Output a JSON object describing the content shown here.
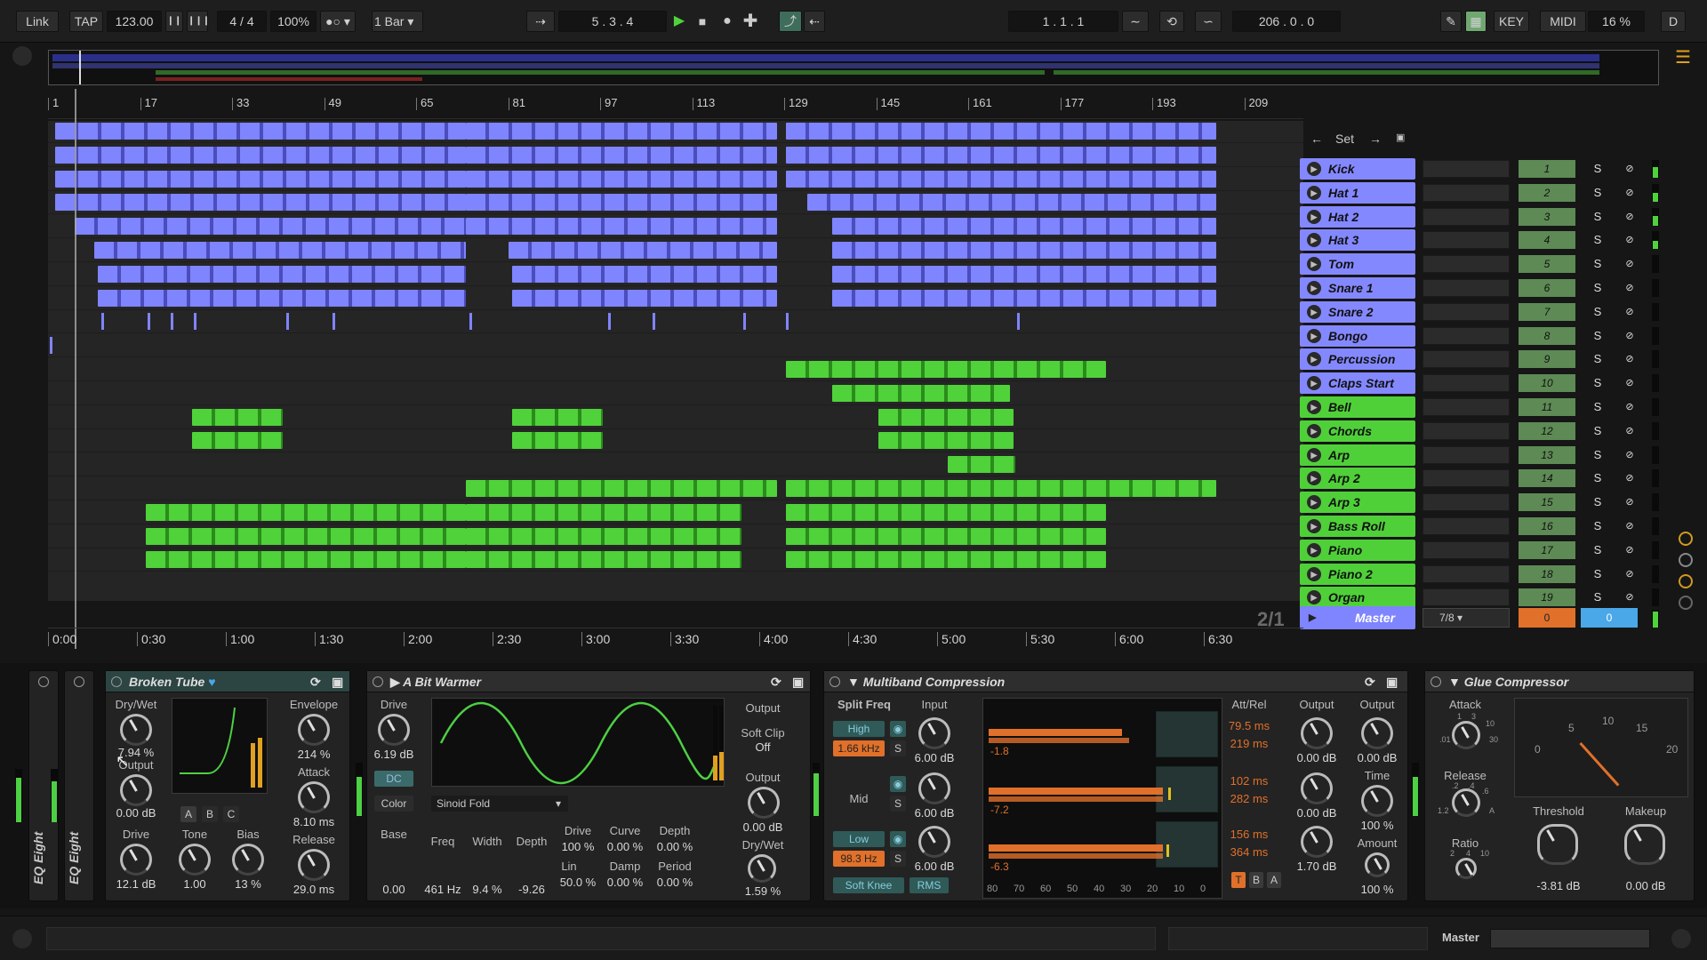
{
  "transport": {
    "link": "Link",
    "tap": "TAP",
    "tempo": "123.00",
    "meter": "4 / 4",
    "zoom": "100%",
    "quant": "1 Bar",
    "position": "5 .  3 .  4",
    "loop_start": "1 .  1 .  1",
    "loop_len": "206 .  0 .  0",
    "key": "KEY",
    "midi": "MIDI",
    "cpu": "16 %",
    "disk": "D"
  },
  "ruler": [
    "1",
    "17",
    "33",
    "49",
    "65",
    "81",
    "97",
    "113",
    "129",
    "145",
    "161",
    "177",
    "193",
    "209"
  ],
  "time_ruler": [
    "0:00",
    "0:30",
    "1:00",
    "1:30",
    "2:00",
    "2:30",
    "3:00",
    "3:30",
    "4:00",
    "4:30",
    "5:00",
    "5:30",
    "6:00",
    "6:30"
  ],
  "set_label": "Set",
  "page_badge": "2/1",
  "tracks": [
    {
      "name": "Kick",
      "num": "1",
      "color": "blue",
      "meter": 0.6
    },
    {
      "name": "Hat 1",
      "num": "2",
      "color": "blue",
      "meter": 0.5
    },
    {
      "name": "Hat 2",
      "num": "3",
      "color": "blue",
      "meter": 0.55
    },
    {
      "name": "Hat 3",
      "num": "4",
      "color": "blue",
      "meter": 0.45
    },
    {
      "name": "Tom",
      "num": "5",
      "color": "blue",
      "meter": 0
    },
    {
      "name": "Snare 1",
      "num": "6",
      "color": "blue",
      "meter": 0
    },
    {
      "name": "Snare 2",
      "num": "7",
      "color": "blue",
      "meter": 0
    },
    {
      "name": "Bongo",
      "num": "8",
      "color": "blue",
      "meter": 0
    },
    {
      "name": "Percussion",
      "num": "9",
      "color": "blue",
      "meter": 0
    },
    {
      "name": "Claps Start",
      "num": "10",
      "color": "blue",
      "meter": 0
    },
    {
      "name": "Bell",
      "num": "11",
      "color": "green",
      "meter": 0
    },
    {
      "name": "Chords",
      "num": "12",
      "color": "green",
      "meter": 0
    },
    {
      "name": "Arp",
      "num": "13",
      "color": "green",
      "meter": 0
    },
    {
      "name": "Arp 2",
      "num": "14",
      "color": "green",
      "meter": 0
    },
    {
      "name": "Arp 3",
      "num": "15",
      "color": "green",
      "meter": 0
    },
    {
      "name": "Bass Roll",
      "num": "16",
      "color": "green",
      "meter": 0
    },
    {
      "name": "Piano",
      "num": "17",
      "color": "green",
      "meter": 0
    },
    {
      "name": "Piano 2",
      "num": "18",
      "color": "green",
      "meter": 0
    },
    {
      "name": "Organ",
      "num": "19",
      "color": "green",
      "meter": 0
    }
  ],
  "master": {
    "name": "Master",
    "routing": "7/8",
    "vol": "0",
    "pan": "0"
  },
  "devices": {
    "eq1": "EQ Eight",
    "eq2": "EQ Eight",
    "broken_tube": {
      "title": "Broken Tube",
      "drywet_label": "Dry/Wet",
      "drywet": "7.94 %",
      "output_label": "Output",
      "output": "0.00 dB",
      "drive_label": "Drive",
      "drive": "12.1 dB",
      "tone_label": "Tone",
      "tone": "1.00",
      "bias_label": "Bias",
      "bias": "13 %",
      "envelope_label": "Envelope",
      "envelope": "214 %",
      "attack_label": "Attack",
      "attack": "8.10 ms",
      "release_label": "Release",
      "release": "29.0 ms",
      "a": "A",
      "b": "B",
      "c": "C"
    },
    "bit_warmer": {
      "title": "A Bit Warmer",
      "drive_label": "Drive",
      "drive": "6.19 dB",
      "dc": "DC",
      "color": "Color",
      "mode": "Sinoid Fold",
      "output_label": "Output",
      "softclip_label": "Soft Clip",
      "softclip": "Off",
      "out2_label": "Output",
      "out2": "0.00 dB",
      "drywet_label": "Dry/Wet",
      "drywet": "1.59 %",
      "base_label": "Base",
      "base": "0.00",
      "freq_label": "Freq",
      "freq": "461 Hz",
      "width_label": "Width",
      "width": "9.4 %",
      "depth_label": "Depth",
      "depth": "-9.26",
      "drive2_label": "Drive",
      "drive2": "100 %",
      "curve_label": "Curve",
      "curve": "0.00 %",
      "depth2_label": "Depth",
      "depth2": "0.00 %",
      "lin_label": "Lin",
      "lin": "50.0 %",
      "damp_label": "Damp",
      "damp": "0.00 %",
      "period_label": "Period",
      "period": "0.00 %"
    },
    "multiband": {
      "title": "Multiband Compression",
      "split_label": "Split Freq",
      "high": "High",
      "high_freq": "1.66 kHz",
      "mid": "Mid",
      "low": "Low",
      "low_freq": "98.3 Hz",
      "soft_knee": "Soft Knee",
      "rms": "RMS",
      "input_label": "Input",
      "in_h": "6.00 dB",
      "in_m": "6.00 dB",
      "in_l": "6.00 dB",
      "attrel_label": "Att/Rel",
      "h_att": "79.5 ms",
      "h_rel": "219 ms",
      "m_att": "102 ms",
      "m_rel": "282 ms",
      "l_att": "156 ms",
      "l_rel": "364 ms",
      "h_db": "-1.8",
      "m_db": "-7.2",
      "l_db": "-6.3",
      "output_label": "Output",
      "out_h": "0.00 dB",
      "out_m": "0.00 dB",
      "out_l": "1.70 dB",
      "scale": [
        "80",
        "70",
        "60",
        "50",
        "40",
        "30",
        "20",
        "10",
        "0"
      ],
      "t": "T",
      "b": "B",
      "a": "A",
      "s": "S"
    },
    "output_col": {
      "output_label": "Output",
      "output": "0.00 dB",
      "time_label": "Time",
      "time": "100 %",
      "amount_label": "Amount",
      "amount": "100 %"
    },
    "glue": {
      "title": "Glue Compressor",
      "attack_label": "Attack",
      "release_label": "Release",
      "ratio_label": "Ratio",
      "threshold_label": "Threshold",
      "threshold": "-3.81 dB",
      "makeup_label": "Makeup",
      "makeup": "0.00 dB",
      "vu": [
        "0",
        "5",
        "10",
        "15",
        "20"
      ],
      "att_scale": [
        "1",
        "3",
        "10",
        ".01",
        "30"
      ],
      "rel_scale": [
        ".2",
        ".4",
        ".6",
        "1.2",
        "A"
      ],
      "ratio_scale": [
        "2",
        "4",
        "10"
      ]
    }
  },
  "status": {
    "master": "Master"
  },
  "colors": {
    "blue_clip": "#7f84ff",
    "green_clip": "#50d23a",
    "meter_green": "#4dd043",
    "orange": "#e0702a"
  }
}
